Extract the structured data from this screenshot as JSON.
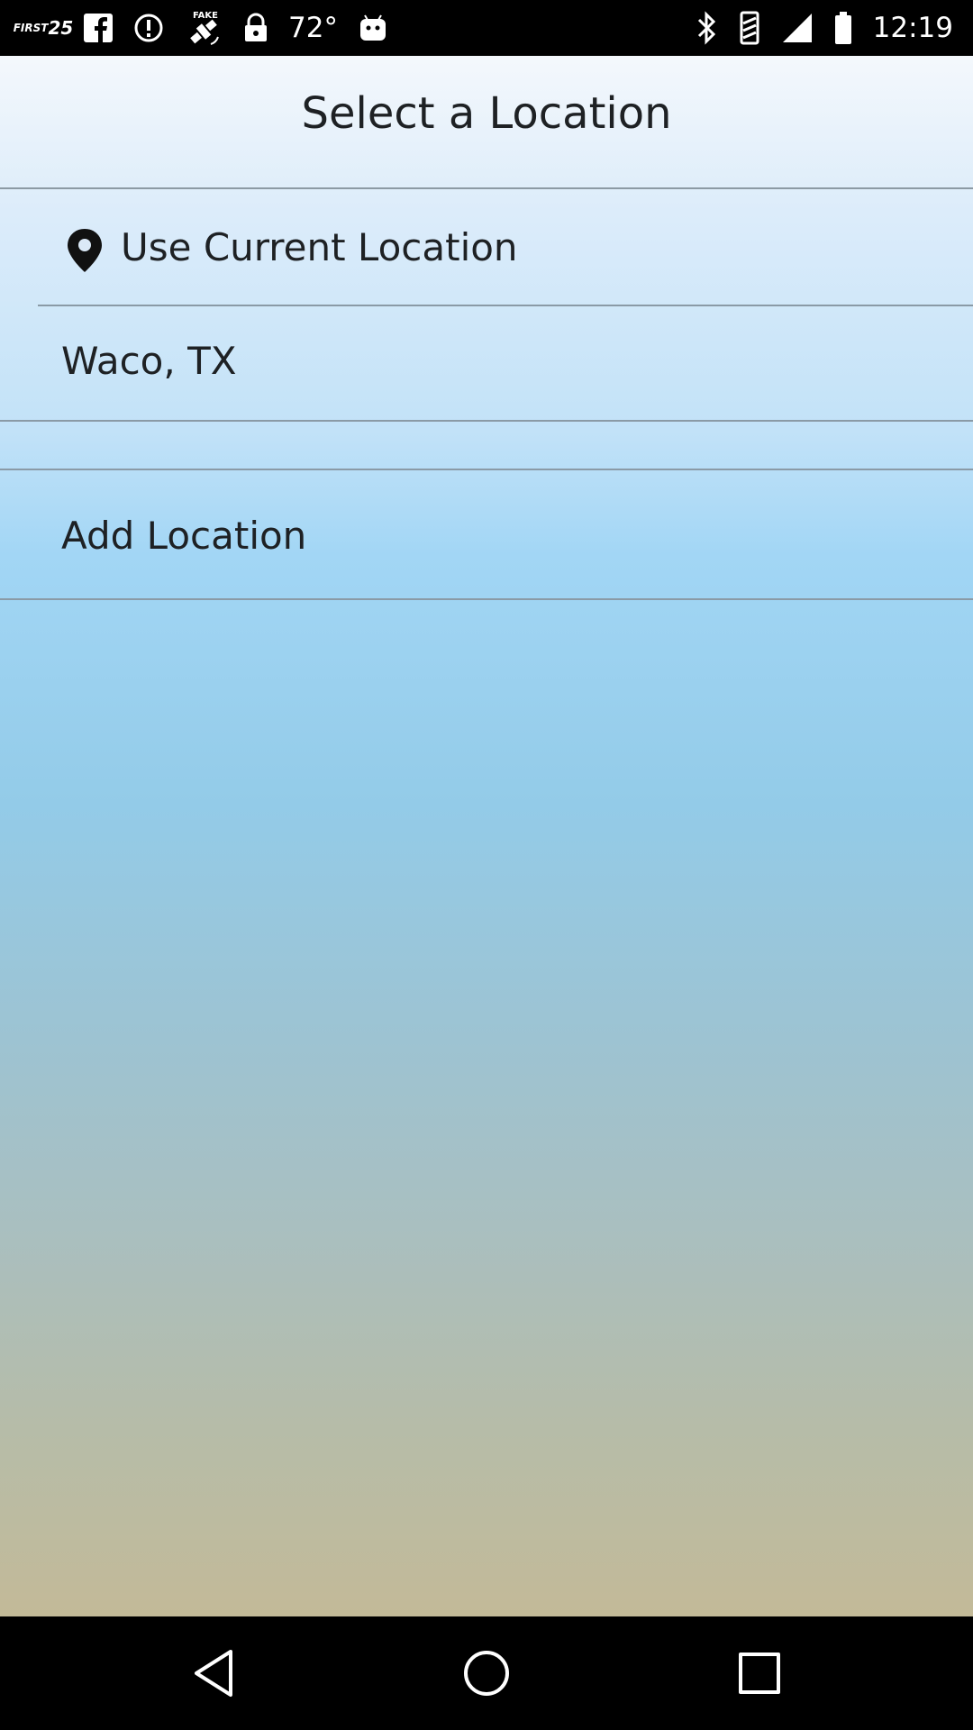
{
  "status_bar": {
    "left_icons": [
      {
        "name": "first-alert-25-icon",
        "line1": "FIRST",
        "line2": "25"
      },
      {
        "name": "facebook-icon"
      },
      {
        "name": "info-circle-icon"
      },
      {
        "name": "fake-gps-icon",
        "label": "FAKE"
      },
      {
        "name": "lock-icon"
      }
    ],
    "temperature": "72°",
    "time": "12:19"
  },
  "header": {
    "title": "Select a Location"
  },
  "locations": {
    "current": {
      "label": "Use Current Location",
      "icon": "location-pin-icon"
    },
    "items": [
      {
        "label": "Waco, TX"
      }
    ],
    "add": {
      "label": "Add Location"
    }
  },
  "colors": {
    "text": "#1e2124",
    "divider": "#8a9aa6",
    "gradient_top": "#f4f8fc",
    "gradient_mid": "#a2d6f5",
    "gradient_bottom": "#c3ba98"
  },
  "nav_bar": {
    "buttons": [
      "back-icon",
      "home-icon",
      "recents-icon"
    ]
  }
}
